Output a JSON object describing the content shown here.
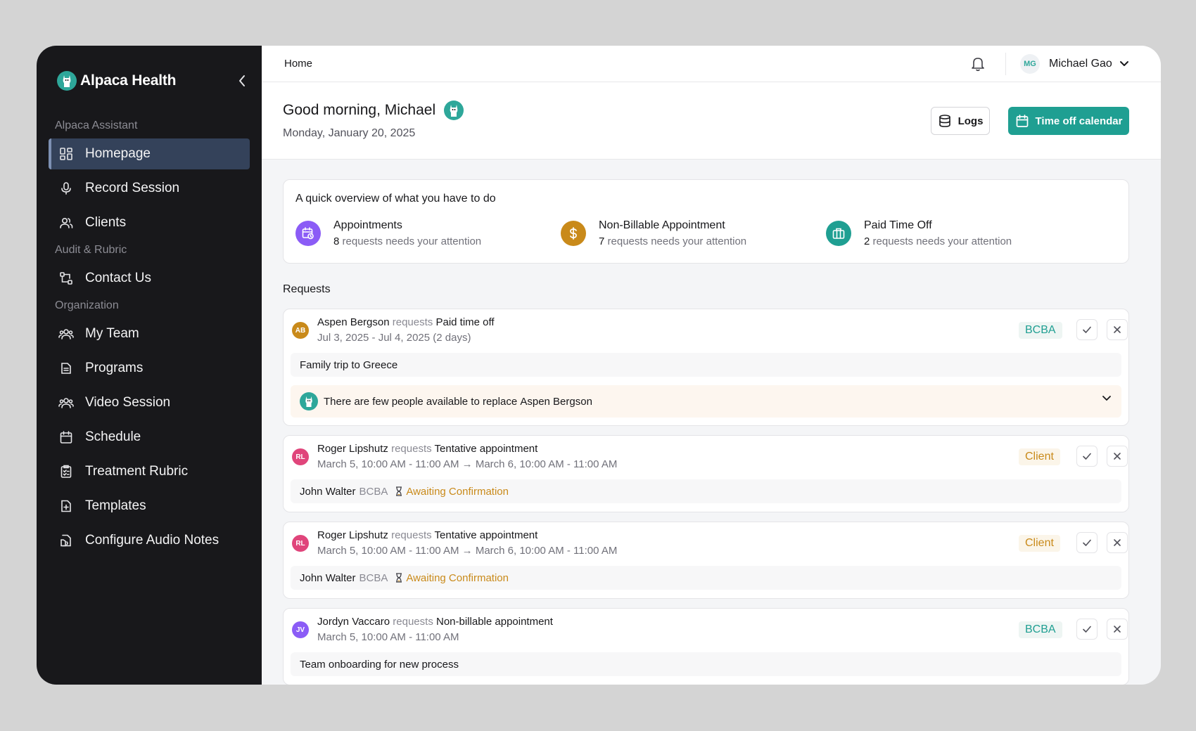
{
  "brand": {
    "name": "Alpaca Health"
  },
  "sidebar": {
    "sections": [
      {
        "label": "Alpaca Assistant",
        "items": [
          {
            "label": "Homepage",
            "icon": "dashboard-icon",
            "active": true
          },
          {
            "label": "Record Session",
            "icon": "microphone-icon"
          },
          {
            "label": "Clients",
            "icon": "users-icon"
          }
        ]
      },
      {
        "label": "Audit & Rubric",
        "items": [
          {
            "label": "Contact Us",
            "icon": "workflow-icon"
          }
        ]
      },
      {
        "label": "Organization",
        "items": [
          {
            "label": "My Team",
            "icon": "team-icon"
          },
          {
            "label": "Programs",
            "icon": "document-icon"
          },
          {
            "label": "Video Session",
            "icon": "team-icon"
          },
          {
            "label": "Schedule",
            "icon": "calendar-icon"
          },
          {
            "label": "Treatment Rubric",
            "icon": "checklist-icon"
          },
          {
            "label": "Templates",
            "icon": "file-plus-icon"
          },
          {
            "label": "Configure Audio Notes",
            "icon": "audio-file-icon"
          }
        ]
      }
    ]
  },
  "topbar": {
    "breadcrumb": "Home",
    "user": {
      "initials": "MG",
      "name": "Michael Gao"
    }
  },
  "header": {
    "greeting": "Good morning, Michael",
    "date": "Monday, January 20, 2025",
    "logs_label": "Logs",
    "time_off_label": "Time off calendar"
  },
  "overview": {
    "title": "A quick overview of what you have to do",
    "items": [
      {
        "name": "Appointments",
        "count": "8",
        "text": "requests needs your attention",
        "color": "#8b5cf6",
        "icon": "calendar-clock-icon"
      },
      {
        "name": "Non-Billable Appointment",
        "count": "7",
        "text": "requests needs your attention",
        "color": "#c98a1a",
        "icon": "dollar-icon"
      },
      {
        "name": "Paid Time Off",
        "count": "2",
        "text": "requests needs your attention",
        "color": "#1f9f92",
        "icon": "briefcase-icon"
      }
    ]
  },
  "requests": {
    "label": "Requests",
    "items": [
      {
        "initials": "AB",
        "avatar_color": "#c98a1a",
        "name": "Aspen Bergson",
        "verb": "requests",
        "type": "Paid time off",
        "when": "Jul 3, 2025 - Jul 4, 2025 (2 days)",
        "tag": "BCBA",
        "tag_kind": "bcba",
        "note": "Family trip to Greece",
        "replace_prefix": "There are few people available to replace",
        "replace_name": "Aspen Bergson"
      },
      {
        "initials": "RL",
        "avatar_color": "#e0457b",
        "name": "Roger Lipshutz",
        "verb": "requests",
        "type": "Tentative appointment",
        "when": "March 5, 10:00 AM - 11:00 AM → March 6, 10:00 AM - 11:00 AM",
        "tag": "Client",
        "tag_kind": "client",
        "assignee": "John Walter",
        "role": "BCBA",
        "status": "Awaiting Confirmation"
      },
      {
        "initials": "RL",
        "avatar_color": "#e0457b",
        "name": "Roger Lipshutz",
        "verb": "requests",
        "type": "Tentative appointment",
        "when": "March 5, 10:00 AM - 11:00 AM → March 6, 10:00 AM - 11:00 AM",
        "tag": "Client",
        "tag_kind": "client",
        "assignee": "John Walter",
        "role": "BCBA",
        "status": "Awaiting Confirmation"
      },
      {
        "initials": "JV",
        "avatar_color": "#8b5cf6",
        "name": "Jordyn Vaccaro",
        "verb": "requests",
        "type": "Non-billable appointment",
        "when": "March 5, 10:00 AM - 11:00 AM",
        "tag": "BCBA",
        "tag_kind": "bcba",
        "note": "Team onboarding for new process"
      }
    ]
  }
}
